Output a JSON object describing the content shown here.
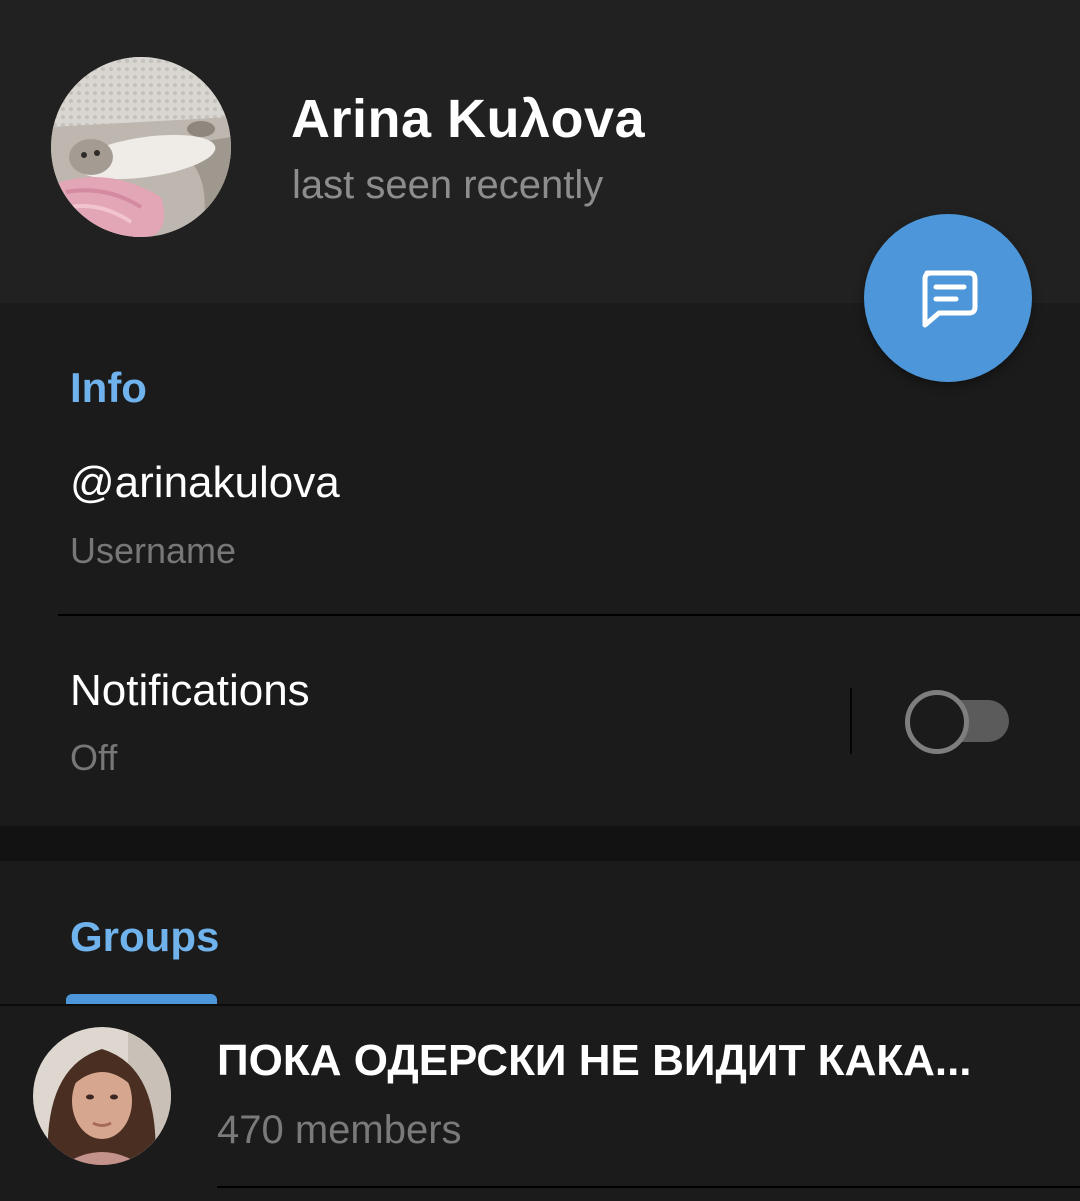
{
  "profile": {
    "name": "Arina Kuλova",
    "status": "last seen recently",
    "avatar_icon": "cat-photo-avatar",
    "message_button_icon": "message-icon"
  },
  "info": {
    "title": "Info",
    "username_value": "@arinakulova",
    "username_label": "Username",
    "notifications_label": "Notifications",
    "notifications_value": "Off",
    "notifications_enabled": false
  },
  "groups": {
    "title": "Groups",
    "items": [
      {
        "name": "ПОКА ОДЕРСКИ НЕ ВИДИТ КАКА...",
        "members": "470 members",
        "avatar_icon": "woman-photo-avatar"
      }
    ]
  },
  "colors": {
    "accent": "#4c96d9",
    "section_title": "#6fb2ec",
    "background": "#1b1b1b",
    "header_background": "#212121"
  }
}
